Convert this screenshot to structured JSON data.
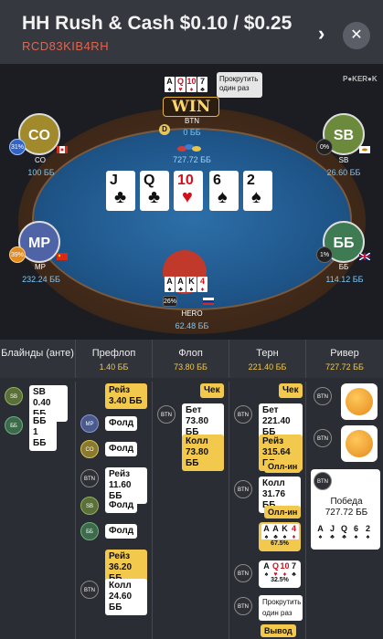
{
  "header": {
    "title": "HH Rush & Cash $0.10 / $0.25",
    "hand_id": "RCD83KIB4RH"
  },
  "table": {
    "watermark": "P●KER●K",
    "win_label": "WIN",
    "tooltip": "Прокрутить один раз",
    "pot": "727.72 ББ",
    "board": [
      {
        "rank": "J",
        "suit": "♣",
        "red": false
      },
      {
        "rank": "Q",
        "suit": "♣",
        "red": false
      },
      {
        "rank": "10",
        "suit": "♥",
        "red": true
      },
      {
        "rank": "6",
        "suit": "♠",
        "red": false
      },
      {
        "rank": "2",
        "suit": "♠",
        "red": false
      }
    ],
    "seats": {
      "btn": {
        "name": "BTN",
        "stack": "0 ББ",
        "cards": [
          {
            "r": "A",
            "s": "♠",
            "red": false
          },
          {
            "r": "Q",
            "s": "♥",
            "red": true
          },
          {
            "r": "10",
            "s": "♦",
            "red": true
          },
          {
            "r": "7",
            "s": "♣",
            "red": false
          }
        ]
      },
      "co": {
        "label": "CO",
        "name": "CO",
        "stack": "100 ББ",
        "pct": "31%"
      },
      "sb": {
        "label": "SB",
        "name": "SB",
        "stack": "26.60 ББ",
        "pct": "0%"
      },
      "mp": {
        "label": "MP",
        "name": "MP",
        "stack": "232.24 ББ",
        "pct": "39%"
      },
      "bb": {
        "label": "ББ",
        "name": "ББ",
        "stack": "114.12 ББ",
        "pct": "1%"
      },
      "hero": {
        "name": "HERO",
        "stack": "62.48 ББ",
        "pct": "26%",
        "cards": [
          {
            "r": "A",
            "s": "♠",
            "red": false
          },
          {
            "r": "A",
            "s": "♣",
            "red": false
          },
          {
            "r": "K",
            "s": "♠",
            "red": false
          },
          {
            "r": "4",
            "s": "♦",
            "red": true
          }
        ]
      }
    }
  },
  "columns": [
    {
      "name": "Блайнды (анте)",
      "value": ""
    },
    {
      "name": "Префлоп",
      "value": "1.40 ББ"
    },
    {
      "name": "Флоп",
      "value": "73.80 ББ"
    },
    {
      "name": "Терн",
      "value": "221.40 ББ"
    },
    {
      "name": "Ривер",
      "value": "727.72 ББ"
    }
  ],
  "blinds": [
    {
      "pos": "SB",
      "text": "SB 0.40 ББ"
    },
    {
      "pos": "ББ",
      "text": "ББ 1 ББ"
    }
  ],
  "preflop": [
    {
      "text": "Рейз 3.40 ББ"
    },
    {
      "pos": "MP",
      "text": "Фолд"
    },
    {
      "pos": "CO",
      "text": "Фолд"
    },
    {
      "pos": "BTN",
      "text": "Рейз 11.60 ББ"
    },
    {
      "pos": "SB",
      "text": "Фолд"
    },
    {
      "pos": "ББ",
      "text": "Фолд"
    },
    {
      "text": "Рейз 36.20 ББ"
    },
    {
      "pos": "BTN",
      "text": "Колл 24.60 ББ"
    }
  ],
  "flop": [
    {
      "text": "Чек"
    },
    {
      "pos": "BTN",
      "text": "Бет 73.80 ББ"
    },
    {
      "text": "Колл 73.80 ББ"
    }
  ],
  "turn": [
    {
      "text": "Чек"
    },
    {
      "pos": "BTN",
      "text": "Бет 221.40 ББ"
    },
    {
      "text": "Рейз 315.64 ББ"
    },
    {
      "tag": "Олл-ин"
    },
    {
      "pos": "BTN",
      "text": "Колл 31.76 ББ"
    },
    {
      "tag": "Олл-ин"
    },
    {
      "equity": "67.5%"
    },
    {
      "pos": "BTN",
      "equity": "32.5%"
    },
    {
      "pos": "BTN",
      "text": "Прокрутить один раз"
    },
    {
      "tag": "Вывод"
    }
  ],
  "river": [
    {
      "pos": "BTN",
      "emoji": "smile"
    },
    {
      "pos": "BTN",
      "emoji": "grin"
    },
    {
      "pos": "BTN",
      "text": "Победа 727.72 ББ"
    }
  ]
}
